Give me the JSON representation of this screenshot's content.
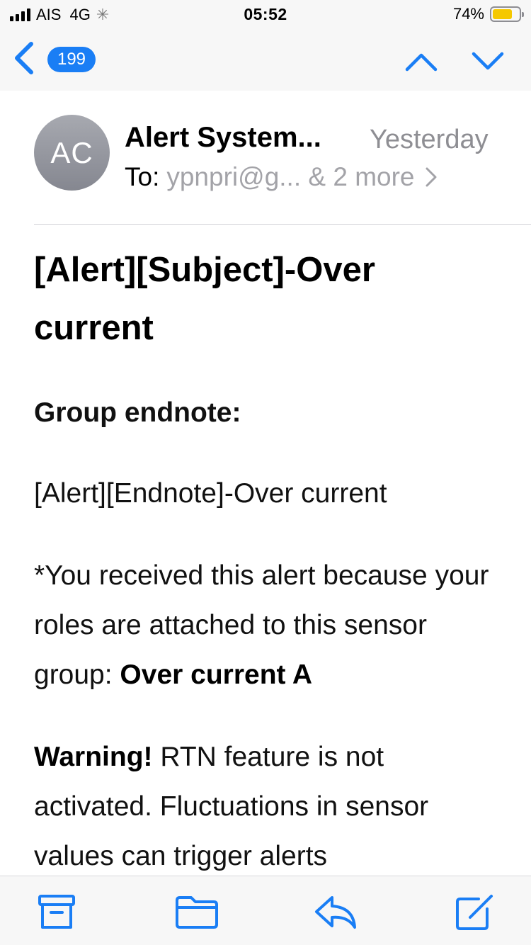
{
  "status_bar": {
    "carrier": "AIS",
    "network": "4G",
    "time": "05:52",
    "battery_percent_text": "74%",
    "battery_level": 0.74,
    "battery_color": "#f5c800"
  },
  "nav": {
    "back_icon": "chevron-left-icon",
    "unread_count": "199",
    "prev_icon": "chevron-up-icon",
    "next_icon": "chevron-down-icon",
    "accent_color": "#1a7ef5"
  },
  "message": {
    "avatar_initials": "AC",
    "sender": "Alert System...",
    "date": "Yesterday",
    "to_label": "To:",
    "to_value": "ypnpri@g... & 2 more",
    "subject": "[Alert][Subject]-Over current",
    "group_title": "Group endnote:",
    "endnote": "[Alert][Endnote]-Over current",
    "notice_text": "*You received this alert because your roles are attached to this sensor group: ",
    "notice_group": "Over current A",
    "warning_label": "Warning!",
    "warning_text": " RTN feature is not activated. Fluctuations in sensor values can trigger alerts"
  },
  "toolbar": {
    "icons": [
      "archive-icon",
      "folder-icon",
      "reply-icon",
      "compose-icon"
    ]
  }
}
